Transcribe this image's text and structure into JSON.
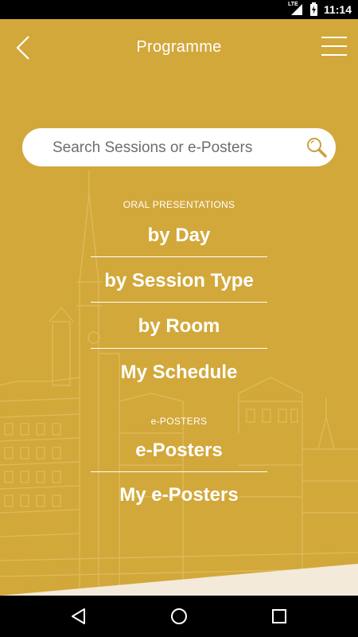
{
  "status_bar": {
    "time": "11:14",
    "network": "LTE",
    "icons": [
      "signal-icon",
      "battery-charging-icon"
    ]
  },
  "header": {
    "title": "Programme",
    "back_icon": "chevron-left-icon",
    "menu_icon": "hamburger-menu-icon"
  },
  "search": {
    "placeholder": "Search Sessions or e-Posters",
    "icon": "magnifier-icon"
  },
  "oral": {
    "section_label": "ORAL PRESENTATIONS",
    "items": [
      {
        "label": "by Day"
      },
      {
        "label": "by Session Type"
      },
      {
        "label": "by Room"
      },
      {
        "label": "My Schedule"
      }
    ]
  },
  "posters": {
    "section_label": "e-POSTERS",
    "items": [
      {
        "label": "e-Posters"
      },
      {
        "label": "My e-Posters"
      }
    ]
  },
  "nav_bar": {
    "icons": [
      "back-triangle-icon",
      "home-circle-icon",
      "recents-square-icon"
    ]
  },
  "colors": {
    "accent": "#D2A83A",
    "text": "#FFFFFF",
    "bar": "#000000"
  }
}
